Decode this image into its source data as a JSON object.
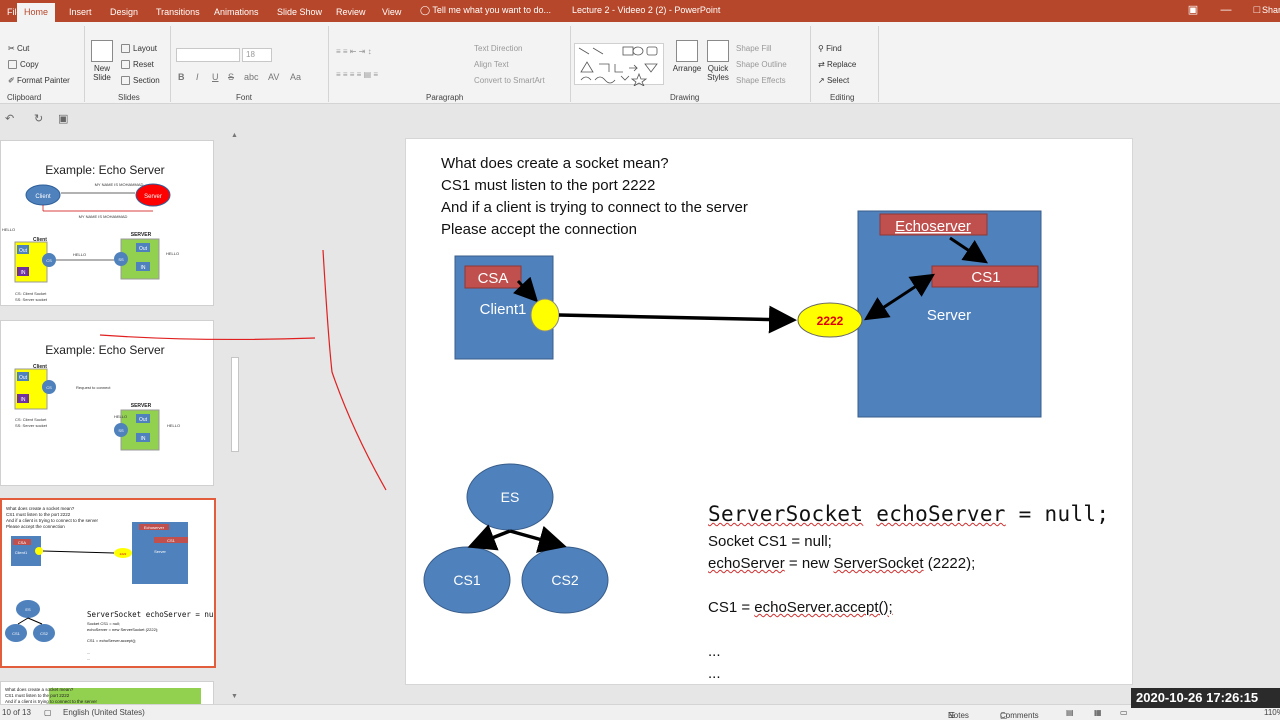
{
  "window": {
    "title": "Lecture 2 - Videeo 2 (2) - PowerPoint",
    "tabs": [
      "File",
      "Home",
      "Insert",
      "Design",
      "Transitions",
      "Animations",
      "Slide Show",
      "Review",
      "View"
    ],
    "tell_me": "Tell me what you want to do...",
    "share_label": "Share"
  },
  "ribbon": {
    "clipboard": {
      "cut": "Cut",
      "copy": "Copy",
      "format_painter": "Format Painter",
      "label": "Clipboard"
    },
    "slides": {
      "new_slide": "New Slide",
      "layout": "Layout",
      "reset": "Reset",
      "section": "Section",
      "label": "Slides"
    },
    "font": {
      "size": "18",
      "bold": "B",
      "italic": "I",
      "underline": "U",
      "strike": "S",
      "shadow": "abc",
      "spacing": "AV",
      "case": "Aa",
      "label": "Font"
    },
    "paragraph": {
      "text_direction": "Text Direction",
      "align_text": "Align Text",
      "smartart": "Convert to SmartArt",
      "label": "Paragraph"
    },
    "drawing": {
      "arrange": "Arrange",
      "quick_styles": "Quick Styles",
      "shape_fill": "Shape Fill",
      "shape_outline": "Shape Outline",
      "shape_effects": "Shape Effects",
      "label": "Drawing"
    },
    "editing": {
      "find": "Find",
      "replace": "Replace",
      "select": "Select",
      "label": "Editing"
    }
  },
  "thumbnails": [
    {
      "title": "Example: Echo Server",
      "client": "Client",
      "server": "Server",
      "msg1": "MY NAME IS MOHAMMAD",
      "msg2": "MY NAME IS MOHAMMAD",
      "client_label": "Client",
      "server_label": "SERVER",
      "out": "Out",
      "in": "IN",
      "cs": "CS",
      "ss": "SS",
      "hello": "HELLO",
      "legend1": "CS: Client Socket",
      "legend2": "SS: Server socket"
    },
    {
      "title": "Example: Echo Server",
      "client_label": "Client",
      "server_label": "SERVER",
      "request": "Request to connect",
      "out": "Out",
      "in": "IN",
      "cs": "CS",
      "ss": "SS",
      "hello": "HELLO",
      "legend1": "CS: Client Socket",
      "legend2": "SS: Server socket"
    },
    {
      "l1": "What does create a socket mean?",
      "l2": "CS1 must listen to the port 2222",
      "l3": "And if a client is trying to connect to the server",
      "l4": "Please accept the connection",
      "csa": "CSA",
      "client1": "Client1",
      "echoserver": "Echoserver",
      "cs1": "CS1",
      "server": "Server",
      "port": "2222",
      "es": "ES",
      "code": "ServerSocket echoServer = null;",
      "c1": "Socket CS1 = null;",
      "c2": "echoServer = new ServerSocket (2222);",
      "c3": "CS1 = echoServer.accept();"
    },
    {
      "l1": "What does create a socket mean?",
      "l2": "CS1 must listen to the port 2222",
      "l3": "And if a client is trying to connect to the server"
    }
  ],
  "slide": {
    "lines": [
      "What does create a socket mean?",
      "CS1 must listen to the port 2222",
      "And if a client is trying to connect to the server",
      "Please accept the connection"
    ],
    "csa": "CSA",
    "client1": "Client1",
    "port": "2222",
    "echoserver": "Echoserver",
    "cs1": "CS1",
    "server": "Server",
    "es": "ES",
    "tree_cs1": "CS1",
    "tree_cs2": "CS2",
    "code_head_a": "ServerSocket",
    "code_head_b": "echoServer",
    "code_head_c": "= null;",
    "code_l1": "Socket CS1 = null;",
    "code_l2_a": "echoServer",
    "code_l2_b": "= new",
    "code_l2_c": "ServerSocket",
    "code_l2_d": "(2222);",
    "code_l3_a": "CS1 =",
    "code_l3_b": "echoServer.accept();",
    "dots1": "...",
    "dots2": "..."
  },
  "status": {
    "slide_of": "10 of 13",
    "language": "English (United States)",
    "notes": "Notes",
    "comments": "Comments",
    "zoom": "110%"
  },
  "overlay_clock": "2020-10-26  17:26:15",
  "colors": {
    "accent": "#b7472a",
    "box_blue": "#4f81bd",
    "label_red": "#c0504d",
    "port_yellow": "#ffff00",
    "pen_red": "#e02020"
  }
}
